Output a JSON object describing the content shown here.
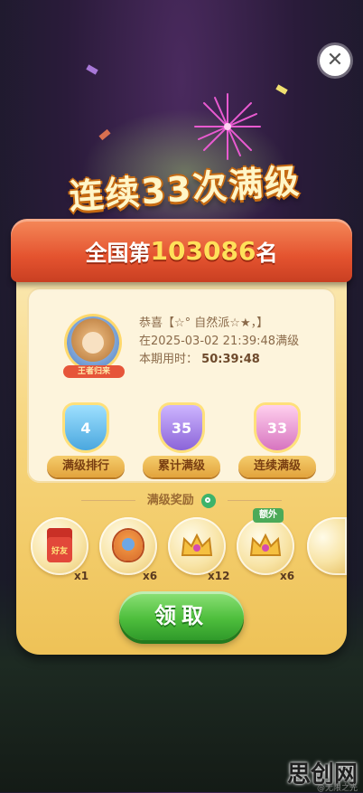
{
  "title": "连续33次满级",
  "banner": {
    "prefix": "全国第",
    "rank": "103086",
    "suffix": "名"
  },
  "avatar": {
    "tag": "王者归来"
  },
  "info": {
    "line1": "恭喜【☆° 自然派☆★，】",
    "line2": "在2025-03-02 21:39:48满级",
    "line3_label": "本期用时：",
    "line3_value": "50:39:48"
  },
  "badges": [
    {
      "value": "4",
      "label": "满级排行",
      "color": "#6ec3f0"
    },
    {
      "value": "35",
      "label": "累计满级",
      "color": "#a984e6"
    },
    {
      "value": "33",
      "label": "连续满级",
      "color": "#e89ad2"
    }
  ],
  "rewards_title": "满级奖励",
  "rewards": [
    {
      "icon": "red-envelope-icon",
      "label": "好友",
      "qty": "x1"
    },
    {
      "icon": "mascot-icon",
      "qty": "x6"
    },
    {
      "icon": "crown-icon",
      "qty": "x12"
    },
    {
      "icon": "crown-icon",
      "qty": "x6",
      "extra": "额外"
    }
  ],
  "claim_label": "领取",
  "watermark": "思创网",
  "watermark_small": "@无限之光"
}
